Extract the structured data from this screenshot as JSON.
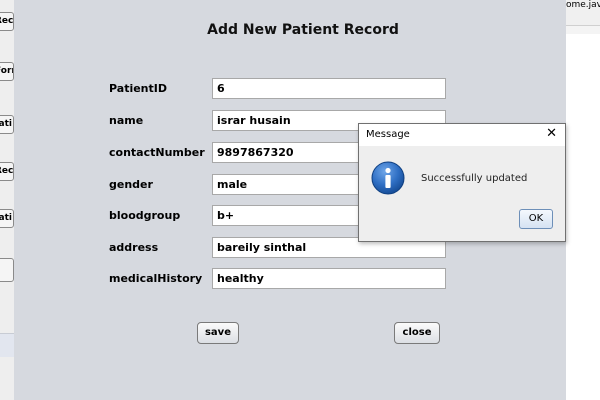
{
  "left_window": {
    "buttons": [
      {
        "label": "Rec"
      },
      {
        "label": "Form"
      },
      {
        "label": "ati"
      },
      {
        "label": "Rec"
      },
      {
        "label": "ati"
      },
      {
        "label": ""
      }
    ]
  },
  "right_window": {
    "path_text": "ome.java"
  },
  "form": {
    "title": "Add New Patient Record",
    "fields": [
      {
        "label": "PatientID",
        "value": "6"
      },
      {
        "label": "name",
        "value": "israr husain"
      },
      {
        "label": "contactNumber",
        "value": "9897867320"
      },
      {
        "label": "gender",
        "value": "male"
      },
      {
        "label": "bloodgroup",
        "value": "b+"
      },
      {
        "label": "address",
        "value": "bareily sinthal"
      },
      {
        "label": "medicalHistory",
        "value": "healthy"
      }
    ],
    "save_label": "save",
    "close_label": "close"
  },
  "dialog": {
    "title": "Message",
    "close_glyph": "✕",
    "icon": "info-icon",
    "message": "Successfully updated",
    "ok_label": "OK",
    "icon_color": "#1f5fb4"
  }
}
